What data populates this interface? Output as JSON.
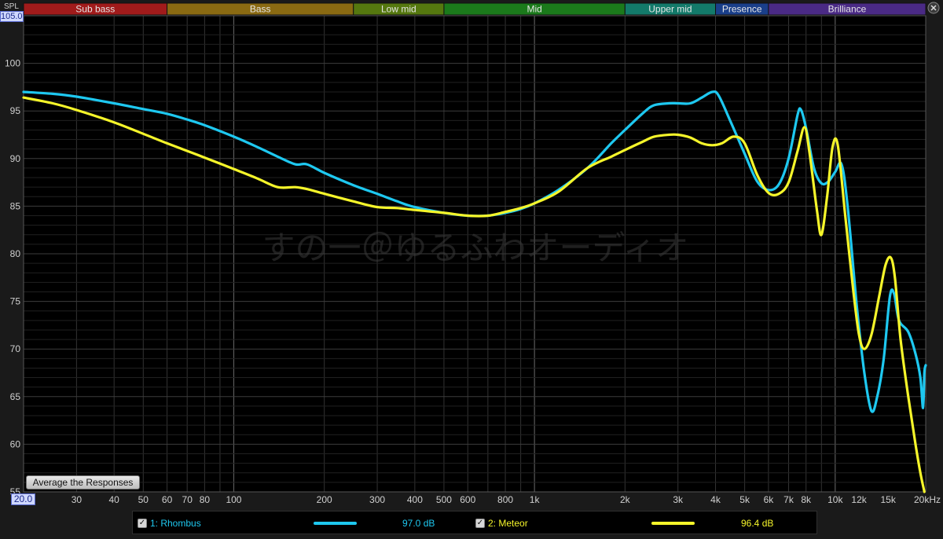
{
  "labels": {
    "spl_axis": "SPL",
    "top_value": "105.00",
    "bottom_value": "20.0",
    "watermark": "すの一＠ゆるふわオーディオ"
  },
  "button": {
    "average_label": "Average the Responses"
  },
  "colors": {
    "rhombus": "#1ec8f0",
    "meteor": "#f5f52a"
  },
  "bands": [
    {
      "label": "Sub bass",
      "from": 20,
      "to": 60,
      "color": "#a11b1b"
    },
    {
      "label": "Bass",
      "from": 60,
      "to": 250,
      "color": "#8a6a12"
    },
    {
      "label": "Low mid",
      "from": 250,
      "to": 500,
      "color": "#55780f"
    },
    {
      "label": "Mid",
      "from": 500,
      "to": 2000,
      "color": "#1b7a1b"
    },
    {
      "label": "Upper mid",
      "from": 2000,
      "to": 4000,
      "color": "#137a6a"
    },
    {
      "label": "Presence",
      "from": 4000,
      "to": 6000,
      "color": "#1a3f8a"
    },
    {
      "label": "Brilliance",
      "from": 6000,
      "to": 20000,
      "color": "#4a2a85"
    }
  ],
  "legend": [
    {
      "check": "✓",
      "name": "1: Rhombus",
      "value": "97.0 dB"
    },
    {
      "check": "✓",
      "name": "2: Meteor",
      "value": "96.4 dB"
    }
  ],
  "chart_data": {
    "type": "line",
    "ylabel": "SPL",
    "xlabel": "",
    "x_scale": "log",
    "xlim": [
      20,
      20000
    ],
    "ylim": [
      55,
      105
    ],
    "y_ticks": [
      55,
      60,
      65,
      70,
      75,
      80,
      85,
      90,
      95,
      100
    ],
    "x_ticks": [
      {
        "v": 20,
        "label": "20.0"
      },
      {
        "v": 30,
        "label": "30"
      },
      {
        "v": 40,
        "label": "40"
      },
      {
        "v": 50,
        "label": "50"
      },
      {
        "v": 60,
        "label": "60"
      },
      {
        "v": 70,
        "label": "70"
      },
      {
        "v": 80,
        "label": "80"
      },
      {
        "v": 100,
        "label": "100"
      },
      {
        "v": 200,
        "label": "200"
      },
      {
        "v": 300,
        "label": "300"
      },
      {
        "v": 400,
        "label": "400"
      },
      {
        "v": 500,
        "label": "500"
      },
      {
        "v": 600,
        "label": "600"
      },
      {
        "v": 800,
        "label": "800"
      },
      {
        "v": 1000,
        "label": "1k"
      },
      {
        "v": 2000,
        "label": "2k"
      },
      {
        "v": 3000,
        "label": "3k"
      },
      {
        "v": 4000,
        "label": "4k"
      },
      {
        "v": 5000,
        "label": "5k"
      },
      {
        "v": 6000,
        "label": "6k"
      },
      {
        "v": 7000,
        "label": "7k"
      },
      {
        "v": 8000,
        "label": "8k"
      },
      {
        "v": 10000,
        "label": "10k"
      },
      {
        "v": 12000,
        "label": "12k"
      },
      {
        "v": 15000,
        "label": "15k"
      },
      {
        "v": 20000,
        "label": "20kHz"
      }
    ],
    "grid": true,
    "series": [
      {
        "name": "1: Rhombus",
        "color": "#1ec8f0",
        "points": [
          [
            20,
            97.0
          ],
          [
            25,
            96.8
          ],
          [
            30,
            96.5
          ],
          [
            40,
            95.8
          ],
          [
            50,
            95.2
          ],
          [
            60,
            94.7
          ],
          [
            70,
            94.1
          ],
          [
            80,
            93.5
          ],
          [
            100,
            92.3
          ],
          [
            120,
            91.2
          ],
          [
            140,
            90.2
          ],
          [
            160,
            89.4
          ],
          [
            175,
            89.4
          ],
          [
            200,
            88.5
          ],
          [
            250,
            87.2
          ],
          [
            300,
            86.3
          ],
          [
            350,
            85.5
          ],
          [
            400,
            84.9
          ],
          [
            500,
            84.3
          ],
          [
            600,
            84.0
          ],
          [
            700,
            84.0
          ],
          [
            800,
            84.3
          ],
          [
            900,
            84.7
          ],
          [
            1000,
            85.3
          ],
          [
            1200,
            86.7
          ],
          [
            1500,
            89.0
          ],
          [
            1800,
            91.6
          ],
          [
            2000,
            93.0
          ],
          [
            2300,
            94.8
          ],
          [
            2500,
            95.6
          ],
          [
            2800,
            95.8
          ],
          [
            3000,
            95.8
          ],
          [
            3300,
            95.8
          ],
          [
            3600,
            96.4
          ],
          [
            3900,
            97.0
          ],
          [
            4100,
            96.6
          ],
          [
            4500,
            93.8
          ],
          [
            5000,
            90.5
          ],
          [
            5500,
            87.6
          ],
          [
            6000,
            86.7
          ],
          [
            6500,
            87.3
          ],
          [
            7000,
            90.0
          ],
          [
            7500,
            94.6
          ],
          [
            7700,
            95.1
          ],
          [
            8000,
            93.2
          ],
          [
            8500,
            89.0
          ],
          [
            9000,
            87.4
          ],
          [
            9500,
            87.6
          ],
          [
            10000,
            88.6
          ],
          [
            10500,
            89.4
          ],
          [
            11000,
            85.0
          ],
          [
            11800,
            74.5
          ],
          [
            12500,
            67.5
          ],
          [
            13200,
            63.5
          ],
          [
            13800,
            65.0
          ],
          [
            14500,
            69.0
          ],
          [
            15200,
            75.5
          ],
          [
            15700,
            75.8
          ],
          [
            16300,
            73.0
          ],
          [
            17500,
            71.8
          ],
          [
            18500,
            69.5
          ],
          [
            19200,
            67.0
          ],
          [
            19600,
            63.8
          ],
          [
            19800,
            67.5
          ],
          [
            20000,
            68.3
          ]
        ]
      },
      {
        "name": "2: Meteor",
        "color": "#f5f52a",
        "points": [
          [
            20,
            96.4
          ],
          [
            25,
            95.8
          ],
          [
            30,
            95.1
          ],
          [
            40,
            93.8
          ],
          [
            50,
            92.6
          ],
          [
            60,
            91.6
          ],
          [
            70,
            90.8
          ],
          [
            80,
            90.1
          ],
          [
            100,
            88.9
          ],
          [
            120,
            87.9
          ],
          [
            140,
            87.0
          ],
          [
            160,
            87.0
          ],
          [
            175,
            86.8
          ],
          [
            200,
            86.3
          ],
          [
            250,
            85.5
          ],
          [
            300,
            84.9
          ],
          [
            350,
            84.8
          ],
          [
            400,
            84.6
          ],
          [
            500,
            84.3
          ],
          [
            600,
            84.0
          ],
          [
            700,
            84.0
          ],
          [
            800,
            84.4
          ],
          [
            900,
            84.8
          ],
          [
            1000,
            85.3
          ],
          [
            1200,
            86.5
          ],
          [
            1500,
            89.0
          ],
          [
            1800,
            90.2
          ],
          [
            2000,
            90.9
          ],
          [
            2300,
            91.8
          ],
          [
            2500,
            92.3
          ],
          [
            2800,
            92.5
          ],
          [
            3000,
            92.5
          ],
          [
            3300,
            92.2
          ],
          [
            3600,
            91.6
          ],
          [
            3900,
            91.4
          ],
          [
            4200,
            91.6
          ],
          [
            4600,
            92.3
          ],
          [
            5000,
            91.6
          ],
          [
            5500,
            88.3
          ],
          [
            6000,
            86.4
          ],
          [
            6500,
            86.3
          ],
          [
            7000,
            87.5
          ],
          [
            7500,
            90.8
          ],
          [
            7900,
            93.3
          ],
          [
            8200,
            90.8
          ],
          [
            8700,
            84.5
          ],
          [
            9000,
            82.0
          ],
          [
            9400,
            86.0
          ],
          [
            9800,
            91.2
          ],
          [
            10200,
            91.4
          ],
          [
            10800,
            84.0
          ],
          [
            11500,
            76.0
          ],
          [
            12000,
            71.5
          ],
          [
            12500,
            70.0
          ],
          [
            13200,
            71.5
          ],
          [
            14000,
            75.5
          ],
          [
            14700,
            78.8
          ],
          [
            15300,
            79.6
          ],
          [
            15800,
            77.5
          ],
          [
            16500,
            71.0
          ],
          [
            17500,
            65.0
          ],
          [
            18500,
            60.0
          ],
          [
            19200,
            57.0
          ],
          [
            19800,
            55.0
          ]
        ]
      }
    ]
  }
}
